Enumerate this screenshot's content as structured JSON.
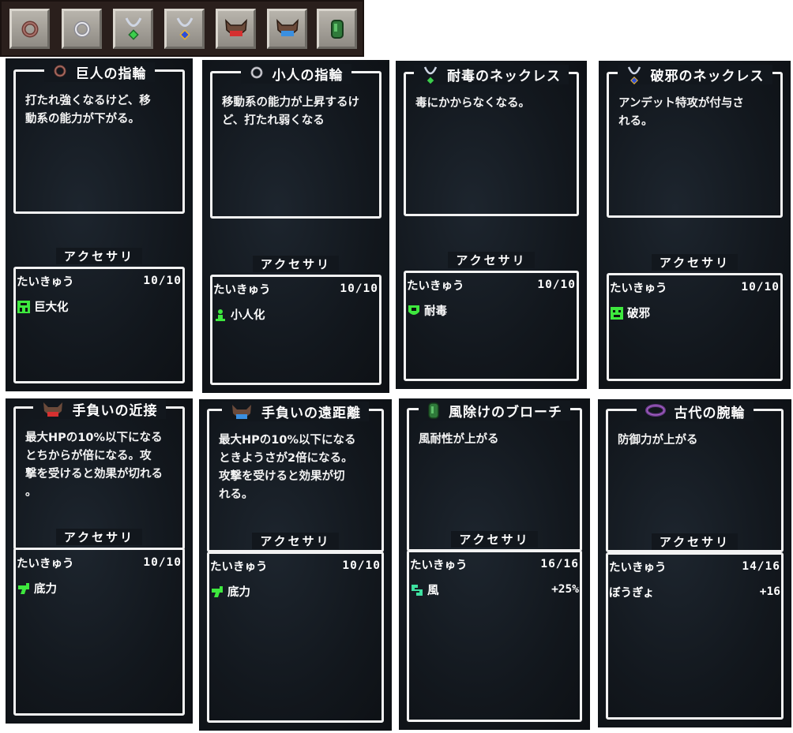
{
  "colors": {
    "frame": "#f2f2f2",
    "effect_green": "#3ee83e",
    "card_bg": "#12171d"
  },
  "itembar": {
    "slots": [
      {
        "icon": "copper-ring-icon"
      },
      {
        "icon": "silver-ring-icon"
      },
      {
        "icon": "green-necklace-icon"
      },
      {
        "icon": "blue-necklace-icon"
      },
      {
        "icon": "red-beast-charm-icon"
      },
      {
        "icon": "blue-beast-charm-icon"
      },
      {
        "icon": "green-brooch-icon"
      }
    ]
  },
  "section_label": "アクセサリ",
  "durability_label": "たいきゅう",
  "cards": [
    {
      "title": "巨人の指輪",
      "icon": "copper-ring-icon",
      "desc": [
        "打たれ強くなるけど、移",
        "動系の能力が下がる。"
      ],
      "durability": "10/10",
      "effect": {
        "name": "巨大化",
        "icon": "giant-effect-icon",
        "value": ""
      }
    },
    {
      "title": "小人の指輪",
      "icon": "silver-ring-icon",
      "desc": [
        "移動系の能力が上昇するけ",
        "ど、打たれ弱くなる"
      ],
      "durability": "10/10",
      "effect": {
        "name": "小人化",
        "icon": "shrink-effect-icon",
        "value": ""
      }
    },
    {
      "title": "耐毒のネックレス",
      "icon": "green-necklace-icon",
      "desc": [
        "毒にかからなくなる。"
      ],
      "durability": "10/10",
      "effect": {
        "name": "耐毒",
        "icon": "poison-resist-effect-icon",
        "value": ""
      }
    },
    {
      "title": "破邪のネックレス",
      "icon": "blue-necklace-icon",
      "desc": [
        "アンデット特攻が付与さ",
        "れる。"
      ],
      "durability": "10/10",
      "effect": {
        "name": "破邪",
        "icon": "skull-effect-icon",
        "value": ""
      }
    },
    {
      "title": "手負いの近接",
      "icon": "red-beast-charm-icon",
      "desc": [
        "最大HPの10%以下になる",
        "とちからが倍になる。攻",
        "撃を受けると効果が切れる",
        "。"
      ],
      "durability": "10/10",
      "effect": {
        "name": "底力",
        "icon": "last-stand-effect-icon",
        "value": ""
      }
    },
    {
      "title": "手負いの遠距離",
      "icon": "blue-beast-charm-icon",
      "desc": [
        "最大HPの10%以下になる",
        "ときようさが2倍になる。",
        "攻撃を受けると効果が切",
        "れる。"
      ],
      "durability": "10/10",
      "effect": {
        "name": "底力",
        "icon": "last-stand-effect-icon",
        "value": ""
      }
    },
    {
      "title": "風除けのブローチ",
      "icon": "green-brooch-icon",
      "desc": [
        "風耐性が上がる"
      ],
      "durability": "16/16",
      "effect": {
        "name": "風",
        "icon": "wind-effect-icon",
        "value": "+25%"
      }
    },
    {
      "title": "古代の腕輪",
      "icon": "purple-bracelet-icon",
      "desc": [
        "防御力が上がる"
      ],
      "durability": "14/16",
      "effect": {
        "name": "ぼうぎょ",
        "icon": "",
        "value": "+16"
      }
    }
  ]
}
